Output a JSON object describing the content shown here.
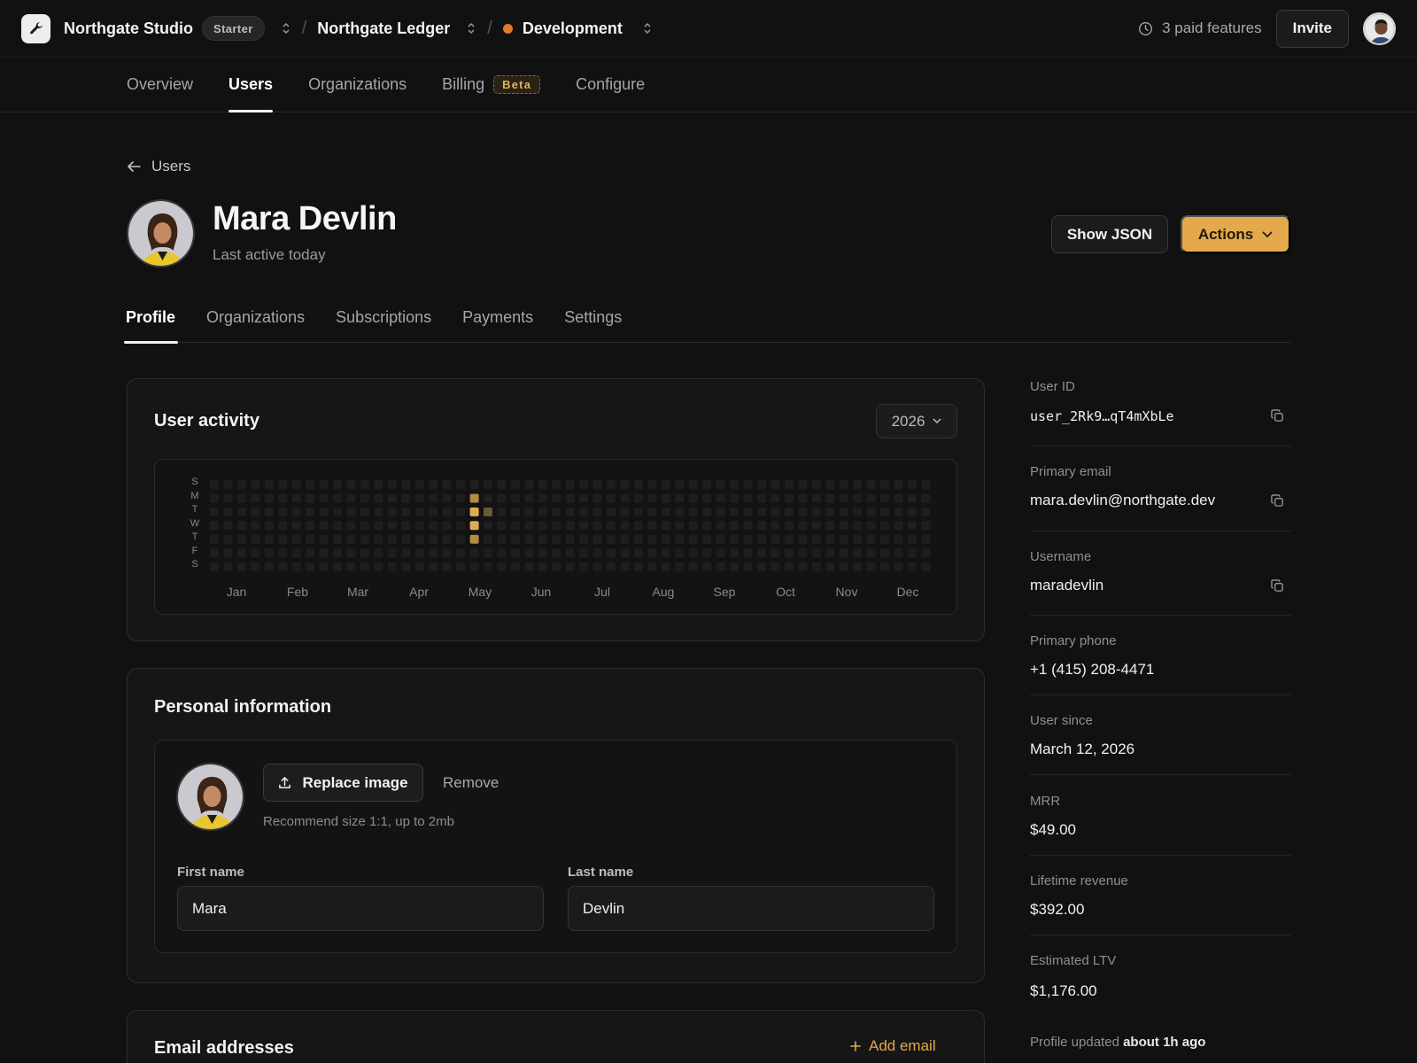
{
  "topbar": {
    "studio_name": "Northgate Studio",
    "plan": "Starter",
    "app_name": "Northgate Ledger",
    "environment": "Development",
    "env_color": "#e0782e",
    "paid_features": "3 paid features",
    "invite_label": "Invite"
  },
  "nav": {
    "items": [
      "Overview",
      "Users",
      "Organizations",
      "Billing",
      "Configure"
    ],
    "active": "Users",
    "beta_badge": "Beta"
  },
  "user": {
    "back_label": "Users",
    "name": "Mara Devlin",
    "last_active": "Last active today",
    "show_json_label": "Show JSON",
    "actions_label": "Actions"
  },
  "tabs": {
    "items": [
      "Profile",
      "Organizations",
      "Subscriptions",
      "Payments",
      "Settings"
    ],
    "active": "Profile"
  },
  "activity": {
    "title": "User activity",
    "year": "2026",
    "day_labels": [
      "S",
      "M",
      "T",
      "W",
      "T",
      "F",
      "S"
    ],
    "months": [
      "Jan",
      "Feb",
      "Mar",
      "Apr",
      "May",
      "Jun",
      "Jul",
      "Aug",
      "Sep",
      "Oct",
      "Nov",
      "Dec"
    ],
    "active_days": [
      {
        "week": 19,
        "day": 1,
        "level": 3
      },
      {
        "week": 19,
        "day": 2,
        "level": 4
      },
      {
        "week": 20,
        "day": 2,
        "level": 2
      },
      {
        "week": 19,
        "day": 3,
        "level": 4
      },
      {
        "week": 19,
        "day": 4,
        "level": 3
      }
    ],
    "colors": {
      "empty": "#1e1e1e",
      "l2": "#6b5a37",
      "l3": "#b48a45",
      "l4": "#e0ab55"
    }
  },
  "personal": {
    "title": "Personal information",
    "replace_label": "Replace image",
    "remove_label": "Remove",
    "hint": "Recommend size 1:1, up to 2mb",
    "first_name_label": "First name",
    "first_name": "Mara",
    "last_name_label": "Last name",
    "last_name": "Devlin"
  },
  "emails": {
    "title": "Email addresses",
    "add_label": "Add email"
  },
  "meta": {
    "items": [
      {
        "label": "User ID",
        "value": "user_2Rk9…qT4mXbLe",
        "copy": true,
        "mono": true
      },
      {
        "label": "Primary email",
        "value": "mara.devlin@northgate.dev",
        "copy": true
      },
      {
        "label": "Username",
        "value": "maradevlin",
        "copy": true
      },
      {
        "label": "Primary phone",
        "value": "+1 (415) 208-4471"
      },
      {
        "label": "User since",
        "value": "March 12, 2026"
      },
      {
        "label": "MRR",
        "value": "$49.00"
      },
      {
        "label": "Lifetime revenue",
        "value": "$392.00"
      },
      {
        "label": "Estimated LTV",
        "value": "$1,176.00"
      }
    ],
    "updated_prefix": "Profile updated",
    "updated_time": "about 1h ago"
  },
  "accent": "#e3a94c"
}
